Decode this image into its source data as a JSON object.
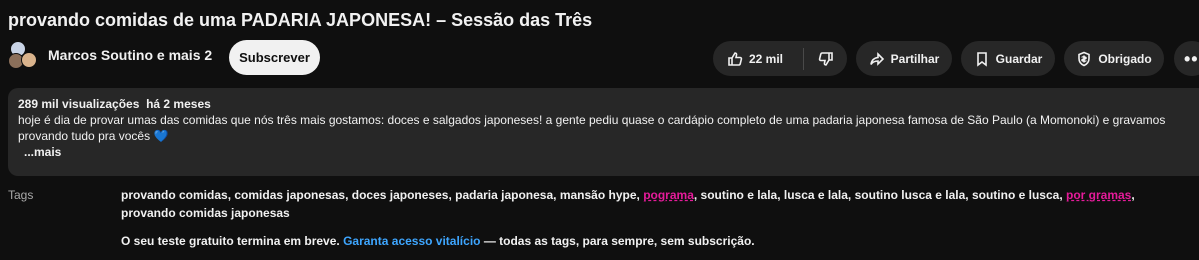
{
  "video": {
    "title": "provando comidas de uma PADARIA JAPONESA! – Sessão das Três"
  },
  "channel": {
    "name": "Marcos Soutino e mais 2",
    "subscribe_label": "Subscrever"
  },
  "actions": {
    "like_count": "22 mil",
    "share_label": "Partilhar",
    "save_label": "Guardar",
    "thanks_label": "Obrigado",
    "more_label": "•••"
  },
  "description": {
    "views": "289 mil visualizações",
    "age": "há 2 meses",
    "text": "hoje é dia de provar umas das comidas que nós três mais gostamos: doces e salgados japoneses!  a gente pediu quase o cardápio completo de uma padaria japonesa famosa de São Paulo (a Momonoki) e gravamos provando tudo pra vocês",
    "emoji": "💙",
    "more_label": "...mais"
  },
  "tags": {
    "label": "Tags",
    "part1": "provando comidas, comidas japonesas, doces japoneses, padaria japonesa, mansão hype, ",
    "hl1": "pograma",
    "part2": ", soutino e lala, lusca e lala, soutino lusca e lala, soutino e lusca, ",
    "hl2": "por gramas",
    "part3": ", provando comidas japonesas",
    "highlight_color": "#e51b9a"
  },
  "trial": {
    "text_before": "O seu teste gratuito termina em breve. ",
    "link": "Garanta acesso vitalício",
    "text_after": " — todas as tags, para sempre, sem subscrição."
  }
}
